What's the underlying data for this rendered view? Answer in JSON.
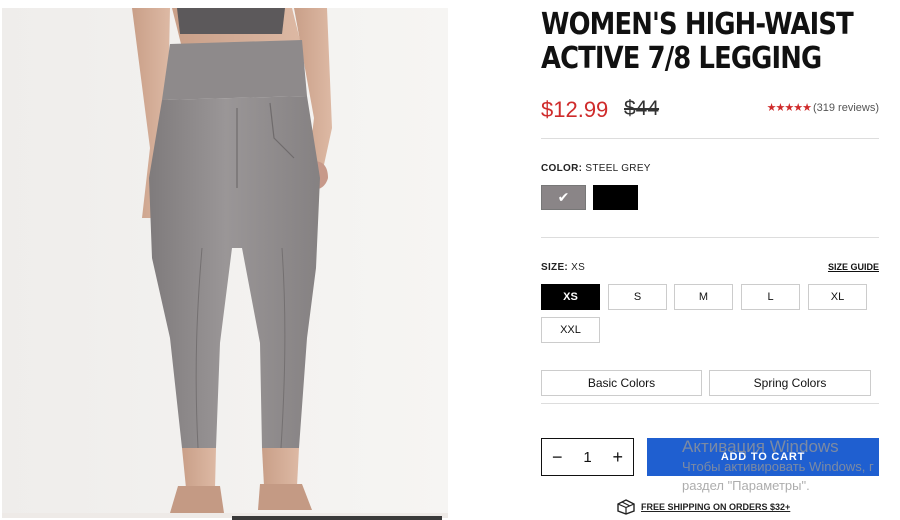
{
  "product": {
    "title_line1": "WOMEN'S HIGH-WAIST",
    "title_line2": "ACTIVE 7/8 LEGGING",
    "price": "$12.99",
    "compare_price": "$44",
    "rating_stars": "★★★★★",
    "reviews": "(319 reviews)"
  },
  "color": {
    "label": "COLOR:",
    "selected": "STEEL GREY",
    "check_glyph": "✔",
    "swatches": [
      {
        "name": "steel-grey",
        "hex": "#8a8587"
      },
      {
        "name": "black",
        "hex": "#000000"
      }
    ]
  },
  "size": {
    "label": "SIZE:",
    "selected": "XS",
    "guide": "SIZE GUIDE",
    "options": [
      "XS",
      "S",
      "M",
      "L",
      "XL",
      "XXL"
    ]
  },
  "filters": [
    "Basic Colors",
    "Spring Colors"
  ],
  "quantity": {
    "minus": "−",
    "value": "1",
    "plus": "+"
  },
  "cart": {
    "label": "ADD TO CART"
  },
  "shipping": {
    "label": "FREE SHIPPING ON ORDERS $32+"
  },
  "watermark": {
    "line1": "Активация Windows",
    "line2": "Чтобы активировать Windows, г",
    "line3": "раздел \"Параметры\"."
  },
  "colors": {
    "accent_red": "#cf2b2b",
    "cart_blue": "#1f5fd0"
  }
}
